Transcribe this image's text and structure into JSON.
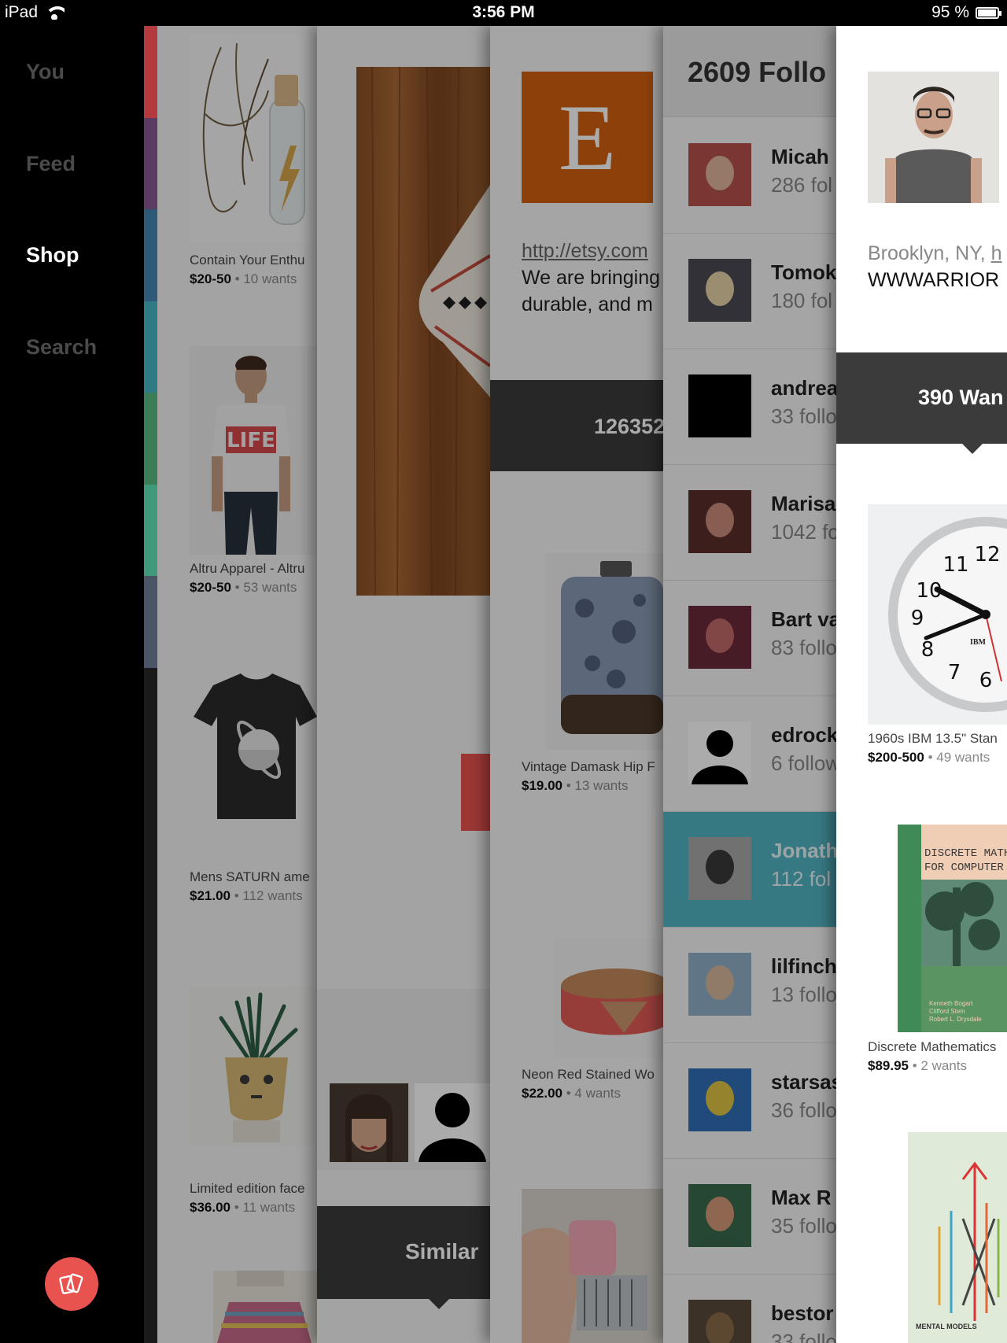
{
  "status_bar": {
    "device": "iPad",
    "time": "3:56 PM",
    "battery": "95 %",
    "battery_level": 0.95
  },
  "sidebar": {
    "items": [
      {
        "label": "You",
        "active": false
      },
      {
        "label": "Feed",
        "active": false
      },
      {
        "label": "Shop",
        "active": true
      },
      {
        "label": "Search",
        "active": false
      }
    ],
    "fab_icon": "cards-icon",
    "strip_colors": [
      "#b53a3d",
      "#5c3b63",
      "#2e5a78",
      "#2f7b85",
      "#3b7d57",
      "#3f9a7b",
      "#4b5568"
    ]
  },
  "shop_panel": {
    "products": [
      {
        "title": "Contain Your Enthu",
        "price": "$20-50",
        "wants": "10 wants"
      },
      {
        "title": "Altru Apparel - Altru",
        "price": "$20-50",
        "wants": "53 wants"
      },
      {
        "title": "Mens SATURN ame",
        "price": "$21.00",
        "wants": "112 wants"
      },
      {
        "title": "Limited edition face",
        "price": "$36.00",
        "wants": "11 wants"
      }
    ],
    "tshirt_text": "LIFE"
  },
  "product_panel": {
    "similar_label": "Similar"
  },
  "shop_detail_panel": {
    "logo_letter": "E",
    "url": "http://etsy.com",
    "description": [
      "We are bringing",
      "durable, and m"
    ],
    "count": "126352",
    "products": [
      {
        "title": "Vintage Damask Hip F",
        "price": "$19.00",
        "wants": "13 wants"
      },
      {
        "title": "Neon Red Stained Wo",
        "price": "$22.00",
        "wants": "4 wants"
      }
    ]
  },
  "followers_panel": {
    "title": "2609 Follo",
    "followers": [
      {
        "name": "Micah",
        "count": "286 fol",
        "selected": false
      },
      {
        "name": "Tomok",
        "count": "180 fol",
        "selected": false
      },
      {
        "name": "andrea",
        "count": "33 follo",
        "selected": false
      },
      {
        "name": "Marisa",
        "count": "1042 fo",
        "selected": false
      },
      {
        "name": "Bart va",
        "count": "83 follo",
        "selected": false
      },
      {
        "name": "edrock",
        "count": "6 follow",
        "selected": false
      },
      {
        "name": "Jonath",
        "count": "112 fol",
        "selected": true
      },
      {
        "name": "lilfinch",
        "count": "13 follo",
        "selected": false
      },
      {
        "name": "starsas",
        "count": "36 follo",
        "selected": false
      },
      {
        "name": "Max R",
        "count": "35 follo",
        "selected": false
      },
      {
        "name": "bestor",
        "count": "33 follo",
        "selected": false
      }
    ]
  },
  "profile_panel": {
    "location": "Brooklyn, NY, ",
    "link": "h",
    "bio": "WWWARRIOR",
    "wants_tab": "390 Wan",
    "products": [
      {
        "title": "1960s IBM 13.5\" Stan",
        "price": "$200-500",
        "wants": "49 wants"
      },
      {
        "title": "Discrete Mathematics",
        "price": "$89.95",
        "wants": "2 wants"
      }
    ],
    "clock_brand": "IBM",
    "book_title": [
      "DISCRETE MATHEMAT",
      "FOR COMPUTER SCI"
    ],
    "book_authors": [
      "Kenneth Bogart",
      "Clifford Stein",
      "Robert L. Drysdale"
    ],
    "book2_title": "MENTAL MODELS"
  }
}
